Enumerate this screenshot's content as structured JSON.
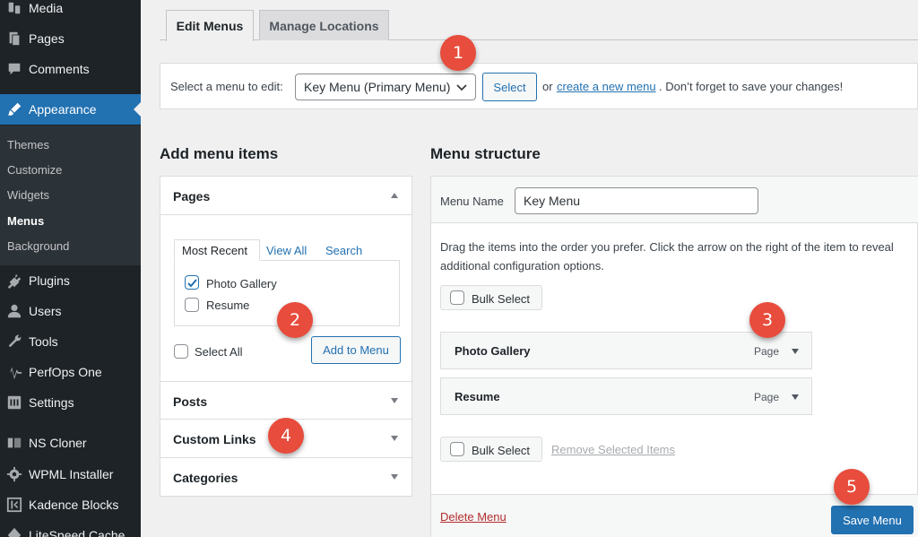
{
  "sidebar": {
    "items": [
      {
        "label": "Media",
        "icon": "media-icon"
      },
      {
        "label": "Pages",
        "icon": "pages-icon"
      },
      {
        "label": "Comments",
        "icon": "comments-icon"
      },
      {
        "label": "Appearance",
        "icon": "paintbrush-icon"
      },
      {
        "label": "Plugins",
        "icon": "plug-icon"
      },
      {
        "label": "Users",
        "icon": "users-icon"
      },
      {
        "label": "Tools",
        "icon": "wrench-icon"
      },
      {
        "label": "PerfOps One",
        "icon": "pulse-icon"
      },
      {
        "label": "Settings",
        "icon": "settings-icon"
      },
      {
        "label": "NS Cloner",
        "icon": "cloner-icon"
      },
      {
        "label": "WPML Installer",
        "icon": "gear-icon"
      },
      {
        "label": "Kadence Blocks",
        "icon": "kadence-icon"
      },
      {
        "label": "LiteSpeed Cache",
        "icon": "litespeed-icon"
      }
    ],
    "submenu": [
      "Themes",
      "Customize",
      "Widgets",
      "Menus",
      "Background"
    ]
  },
  "tabs": {
    "edit": "Edit Menus",
    "locations": "Manage Locations"
  },
  "select_bar": {
    "label": "Select a menu to edit:",
    "selected": "Key Menu (Primary Menu)",
    "select_button": "Select",
    "or_text": "or",
    "create_link": "create a new menu",
    "tail_text": ". Don’t forget to save your changes!"
  },
  "add_items": {
    "heading": "Add menu items",
    "pages": {
      "title": "Pages",
      "tabs": [
        "Most Recent",
        "View All",
        "Search"
      ],
      "list": [
        {
          "label": "Photo Gallery",
          "checked": true
        },
        {
          "label": "Resume",
          "checked": false
        }
      ],
      "select_all": "Select All",
      "add_button": "Add to Menu"
    },
    "sections": [
      "Posts",
      "Custom Links",
      "Categories"
    ]
  },
  "structure": {
    "heading": "Menu structure",
    "menu_name_label": "Menu Name",
    "menu_name_value": "Key Menu",
    "instructions": "Drag the items into the order you prefer. Click the arrow on the right of the item to reveal additional configuration options.",
    "bulk_select": "Bulk Select",
    "items": [
      {
        "title": "Photo Gallery",
        "type": "Page"
      },
      {
        "title": "Resume",
        "type": "Page"
      }
    ],
    "remove_selected": "Remove Selected Items",
    "delete_menu": "Delete Menu",
    "save_button": "Save Menu"
  },
  "callouts": [
    "1",
    "2",
    "3",
    "4",
    "5"
  ],
  "colors": {
    "accent": "#2271b1",
    "sidebar": "#1d2327",
    "badge": "#e74c3c",
    "delete": "#b32d2e"
  }
}
